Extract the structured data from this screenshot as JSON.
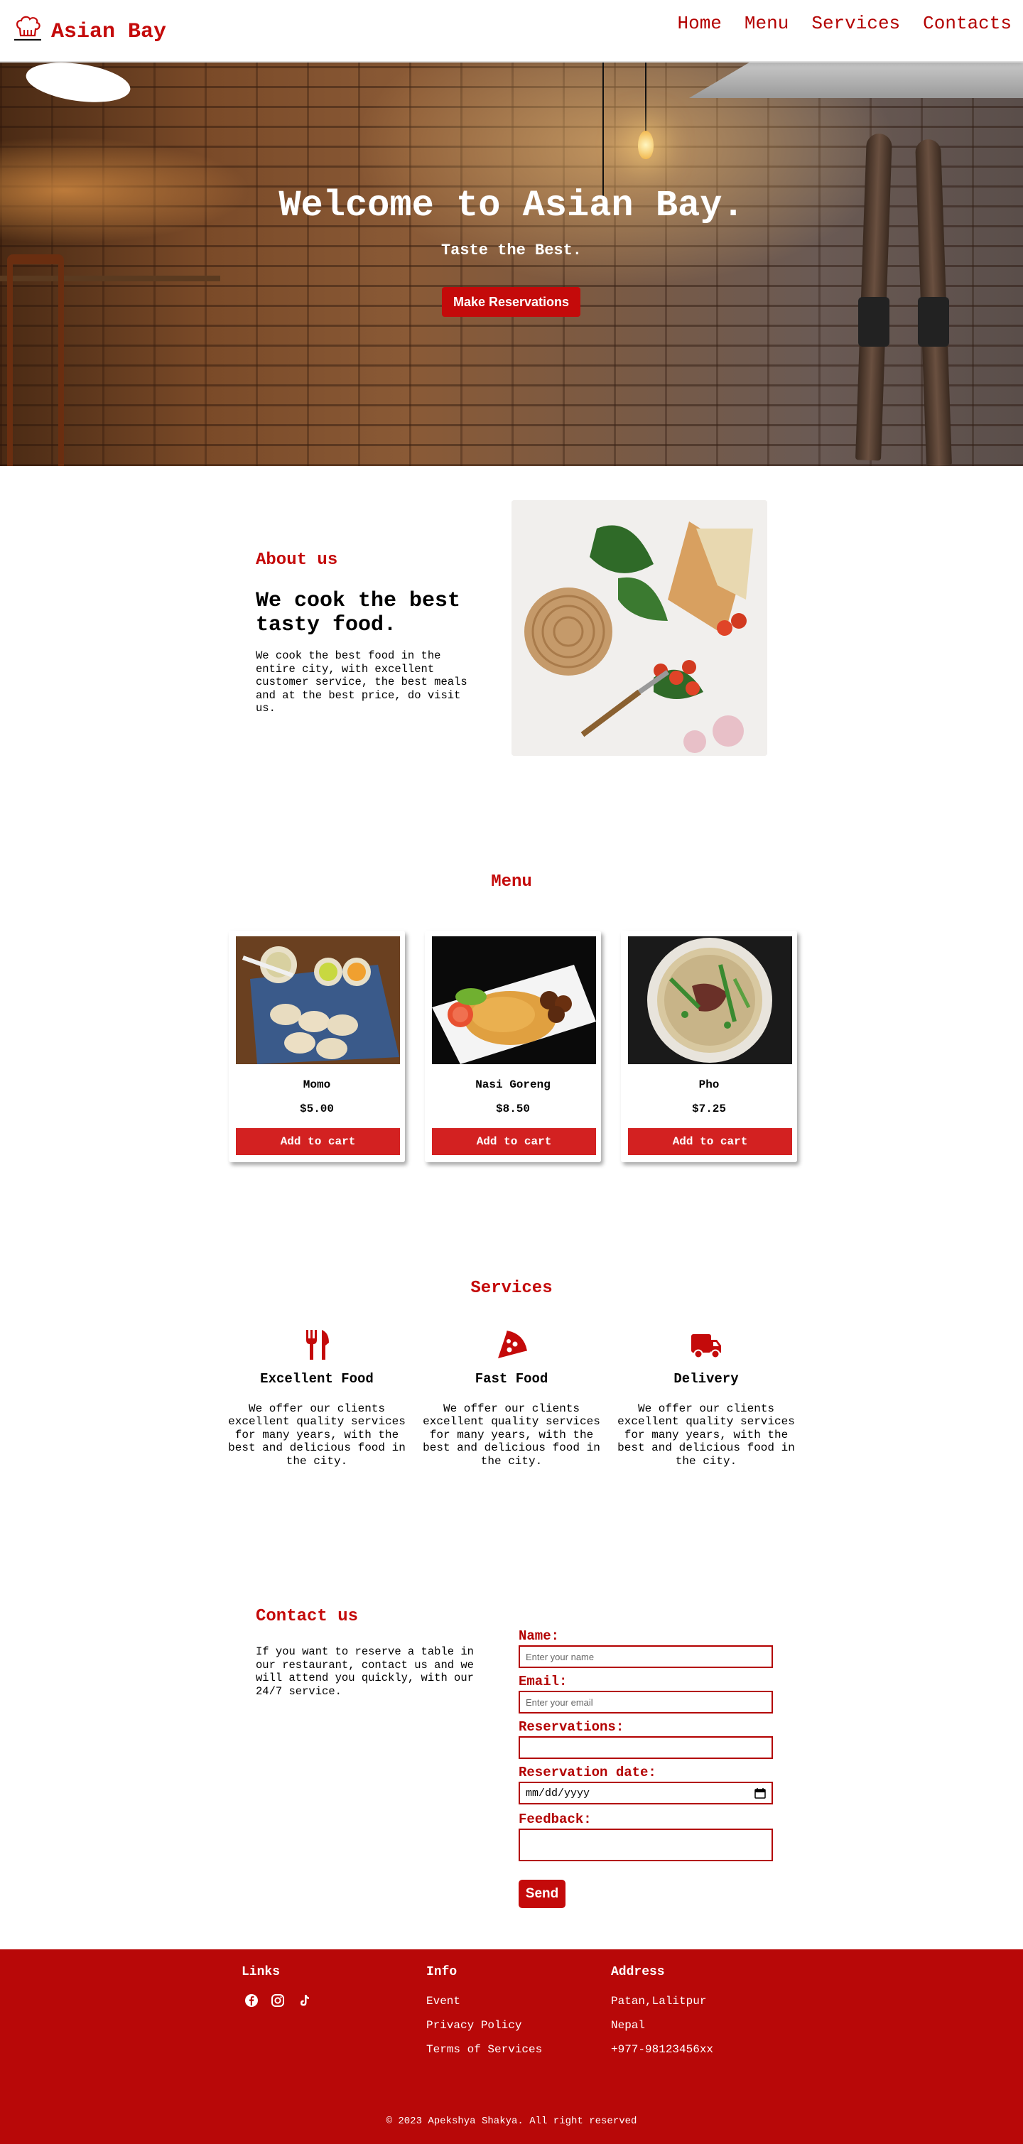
{
  "brand": {
    "name": "Asian Bay"
  },
  "nav": [
    "Home",
    "Menu",
    "Services",
    "Contacts"
  ],
  "hero": {
    "title": "Welcome to Asian Bay.",
    "subtitle": "Taste the Best.",
    "button": "Make Reservations"
  },
  "about": {
    "label": "About us",
    "title": "We cook the best tasty food.",
    "text": "We cook the best food in the entire city, with excellent customer service, the best meals and at the best price, do visit us."
  },
  "menu": {
    "title": "Menu",
    "items": [
      {
        "name": "Momo",
        "price": "$5.00",
        "button": "Add to cart"
      },
      {
        "name": "Nasi Goreng",
        "price": "$8.50",
        "button": "Add to cart"
      },
      {
        "name": "Pho",
        "price": "$7.25",
        "button": "Add to cart"
      }
    ]
  },
  "services": {
    "title": "Services",
    "items": [
      {
        "name": "Excellent Food",
        "icon": "utensils-icon",
        "text": "We offer our clients excellent quality services for many years, with the best and delicious food in the city."
      },
      {
        "name": "Fast Food",
        "icon": "pizza-slice-icon",
        "text": "We offer our clients excellent quality services for many years, with the best and delicious food in the city."
      },
      {
        "name": "Delivery",
        "icon": "truck-icon",
        "text": "We offer our clients excellent quality services for many years, with the best and delicious food in the city."
      }
    ]
  },
  "contact": {
    "title": "Contact us",
    "text": "If you want to reserve a table in our restaurant, contact us and we will attend you quickly, with our 24/7 service.",
    "fields": {
      "name_label": "Name:",
      "name_placeholder": "Enter your name",
      "email_label": "Email:",
      "email_placeholder": "Enter your email",
      "reservations_label": "Reservations:",
      "date_label": "Reservation date:",
      "date_value": "mm/dd/yyyy",
      "feedback_label": "Feedback:"
    },
    "send": "Send"
  },
  "footer": {
    "links_heading": "Links",
    "info_heading": "Info",
    "info_items": [
      "Event",
      "Privacy Policy",
      "Terms of Services"
    ],
    "address_heading": "Address",
    "address_items": [
      "Patan,Lalitpur",
      "Nepal",
      "+977-98123456xx"
    ],
    "copyright": "© 2023 Apekshya Shakya. All right reserved"
  },
  "colors": {
    "accent": "#c40a0a",
    "footer": "#b80808"
  }
}
